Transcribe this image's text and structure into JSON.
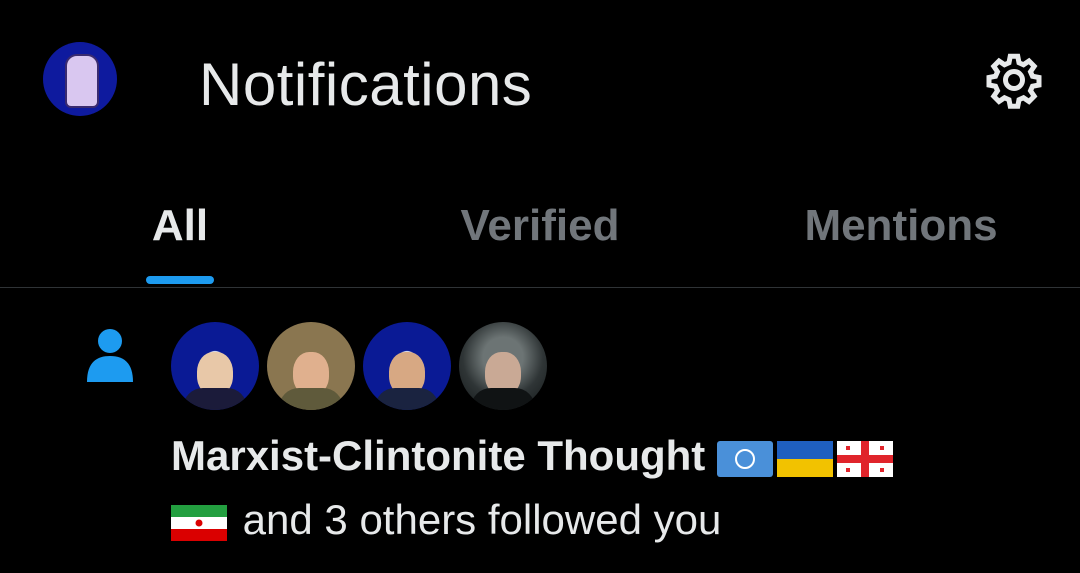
{
  "header": {
    "title": "Notifications",
    "settings_icon": "gear-icon",
    "avatar_icon": "profile-avatar"
  },
  "tabs": [
    {
      "label": "All",
      "active": true
    },
    {
      "label": "Verified",
      "active": false
    },
    {
      "label": "Mentions",
      "active": false
    }
  ],
  "notification": {
    "icon": "person-icon",
    "name": "Marxist-Clintonite Thought",
    "rest": "and 3 others followed you",
    "flags": [
      "un-flag-icon",
      "ukraine-flag-icon",
      "georgia-flag-icon",
      "iran-flag-icon"
    ],
    "avatars": 4
  },
  "colors": {
    "background": "#000000",
    "text": "#e7e9ea",
    "muted": "#71767b",
    "accent": "#1d9bf0",
    "divider": "#2f3336"
  }
}
